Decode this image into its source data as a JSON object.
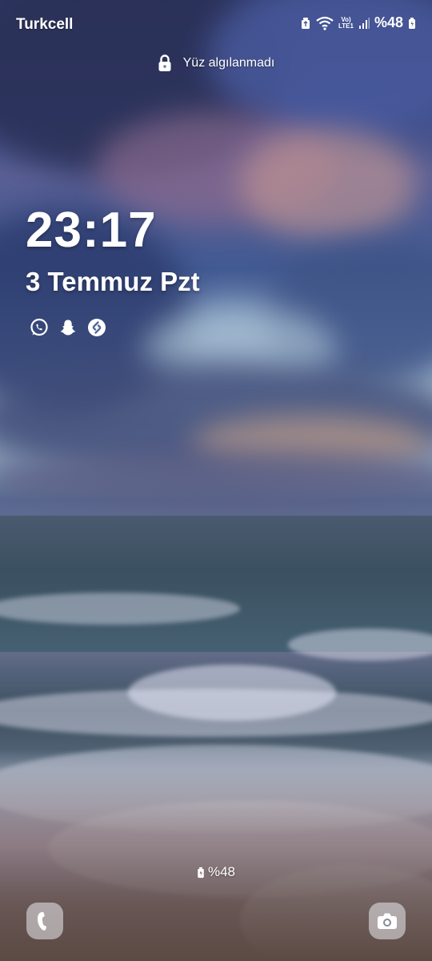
{
  "status_bar": {
    "carrier": "Turkcell",
    "battery_text": "%48",
    "network_label_top": "Vo)",
    "network_label_bottom": "LTE1",
    "icons": [
      "recycle-icon",
      "wifi-icon",
      "volte-lte-icon",
      "signal-icon",
      "battery-charging-icon"
    ]
  },
  "lock": {
    "face_status": "Yüz algılanmadı",
    "icon": "lock-icon"
  },
  "clock": {
    "time": "23:17",
    "date": "3 Temmuz Pzt"
  },
  "notifications": {
    "icons": [
      "whatsapp-icon",
      "snapchat-icon",
      "shazam-icon"
    ]
  },
  "bottom": {
    "battery_text": "%48",
    "left_shortcut": "phone-icon",
    "right_shortcut": "camera-icon"
  },
  "colors": {
    "text": "#ffffff",
    "shortcut_bg": "#ebebf0"
  }
}
